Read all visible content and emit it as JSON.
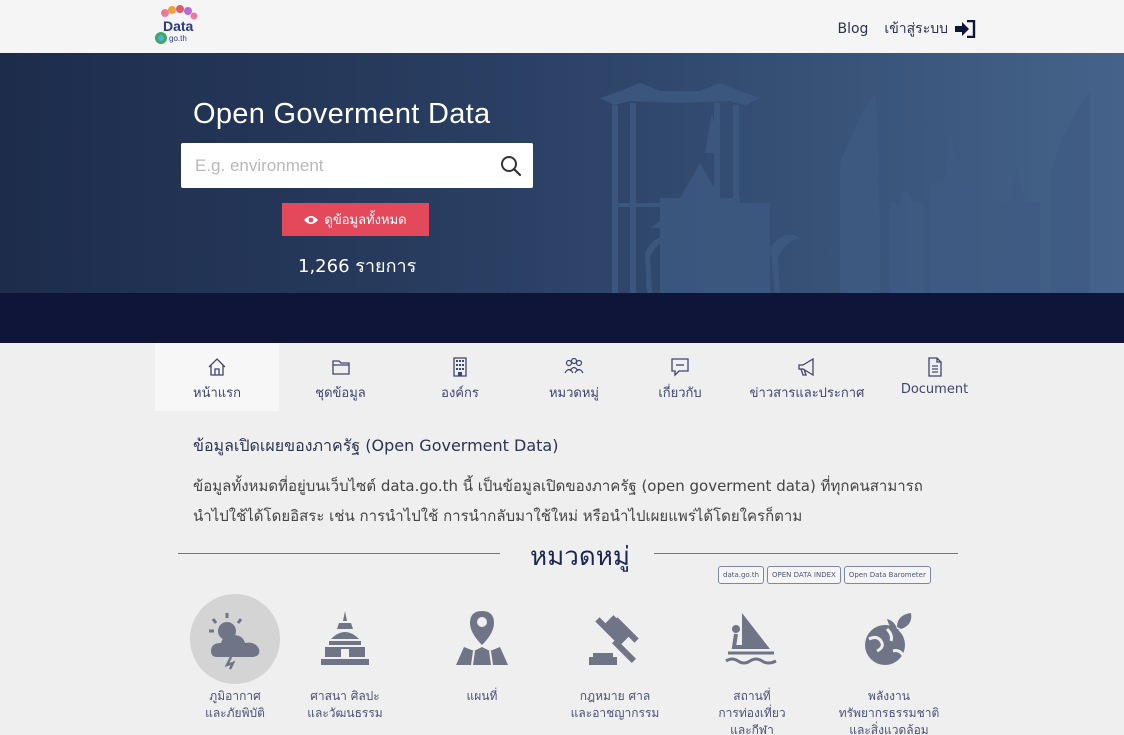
{
  "header": {
    "logo_text": "Data",
    "logo_subtext": "go.th",
    "blog_label": "Blog",
    "login_label": "เข้าสู่ระบบ"
  },
  "hero": {
    "title": "Open Goverment Data",
    "search_placeholder": "E.g. environment",
    "view_all_label": "ดูข้อมูลทั้งหมด",
    "count_text": "1,266 รายการ"
  },
  "tabs": [
    {
      "label": "หน้าแรก",
      "icon": "home-icon"
    },
    {
      "label": "ชุดข้อมูล",
      "icon": "folder-icon"
    },
    {
      "label": "องค์กร",
      "icon": "building-icon"
    },
    {
      "label": "หมวดหมู่",
      "icon": "group-icon"
    },
    {
      "label": "เกี่ยวกับ",
      "icon": "chat-icon"
    },
    {
      "label": "ข่าวสารและประกาศ",
      "icon": "megaphone-icon"
    },
    {
      "label": "Document",
      "icon": "document-icon"
    }
  ],
  "main": {
    "section_title": "ข้อมูลเปิดเผยของภาครัฐ (Open Goverment Data)",
    "desc_line1": "ข้อมูลทั้งหมดที่อยู่บนเว็บไซต์ data.go.th นี้ เป็นข้อมูลเปิดของภาครัฐ (open goverment data) ที่ทุกคนสามารถ",
    "desc_line2": "นำไปใช้ได้โดยอิสระ เช่น การนำไปใช้ การนำกลับมาใช้ใหม่ หรือนำไปเผยแพร่ได้โดยใครก็ตาม",
    "category_heading": "หมวดหมู่",
    "badges": [
      "data.go.th",
      "OPEN DATA INDEX",
      "Open Data Barometer"
    ]
  },
  "categories": [
    {
      "line1": "ภูมิอากาศ",
      "line2": "และภัยพิบัติ",
      "line3": "",
      "icon": "weather-icon"
    },
    {
      "line1": "ศาสนา ศิลปะ",
      "line2": "และวัฒนธรรม",
      "line3": "",
      "icon": "temple-icon"
    },
    {
      "line1": "แผนที่",
      "line2": "",
      "line3": "",
      "icon": "map-pin-icon"
    },
    {
      "line1": "กฎหมาย ศาล",
      "line2": "และอาชญากรรม",
      "line3": "",
      "icon": "gavel-icon"
    },
    {
      "line1": "สถานที่",
      "line2": "การท่องเที่ยว",
      "line3": "และกีฬา",
      "icon": "windsurf-icon"
    },
    {
      "line1": "พลังงาน",
      "line2": "ทรัพยากรธรรมชาติ",
      "line3": "และสิ่งแวดล้อม",
      "icon": "earth-plant-icon"
    }
  ],
  "colors": {
    "accent_red": "#e3495b",
    "navy": "#0f1439",
    "icon_gray": "#707487"
  }
}
